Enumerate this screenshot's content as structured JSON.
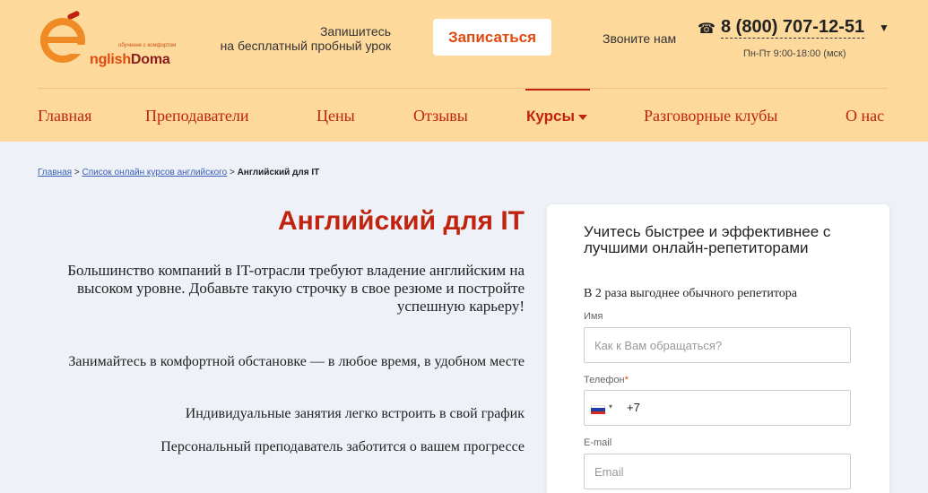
{
  "header": {
    "logo_brand_prefix": "nglish",
    "logo_brand_suffix": "Doma",
    "logo_slogan": "обучение с комфортом",
    "promo_line1": "Запишитесь",
    "promo_line2": "на бесплатный пробный урок",
    "signup_label": "Записаться",
    "call_us": "Звоните нам",
    "phone": "8 (800) 707-12-51",
    "hours": "Пн-Пт 9:00-18:00 (мск)",
    "colors": {
      "background": "#fdd99b",
      "accent": "#c0240f",
      "logo_orange": "#e04a0e"
    }
  },
  "nav": {
    "items": [
      {
        "label": "Главная"
      },
      {
        "label": "Преподаватели"
      },
      {
        "label": "Цены"
      },
      {
        "label": "Отзывы"
      },
      {
        "label": "Курсы"
      },
      {
        "label": "Разговорные клубы"
      },
      {
        "label": "О нас"
      }
    ],
    "active": "Курсы"
  },
  "breadcrumb": {
    "home": "Главная",
    "separator": ">",
    "list": "Список онлайн курсов английского",
    "current": "Английский для IT"
  },
  "main": {
    "title": "Английский для IT",
    "lead": "Большинство компаний в IT-отрасли требуют владение английским на высоком уровне. Добавьте такую строчку в свое резюме и постройте успешную карьеру!",
    "features": [
      "Занимайтесь в комфортной обстановке — в любое время, в удобном месте",
      "Индивидуальные занятия легко встроить в свой график",
      "Персональный преподаватель заботится о вашем прогрессе"
    ]
  },
  "form": {
    "title": "Учитесь быстрее и эффективнее с лучшими онлайн-репетиторами",
    "subtitle": "В 2 раза выгоднее обычного репетитора",
    "name_label": "Имя",
    "name_placeholder": "Как к Вам обращаться?",
    "phone_label": "Телефон",
    "phone_required_mark": "*",
    "phone_prefix": "+7",
    "phone_country_icon": "russia-flag-icon",
    "email_label": "E-mail",
    "email_placeholder": "Email"
  }
}
